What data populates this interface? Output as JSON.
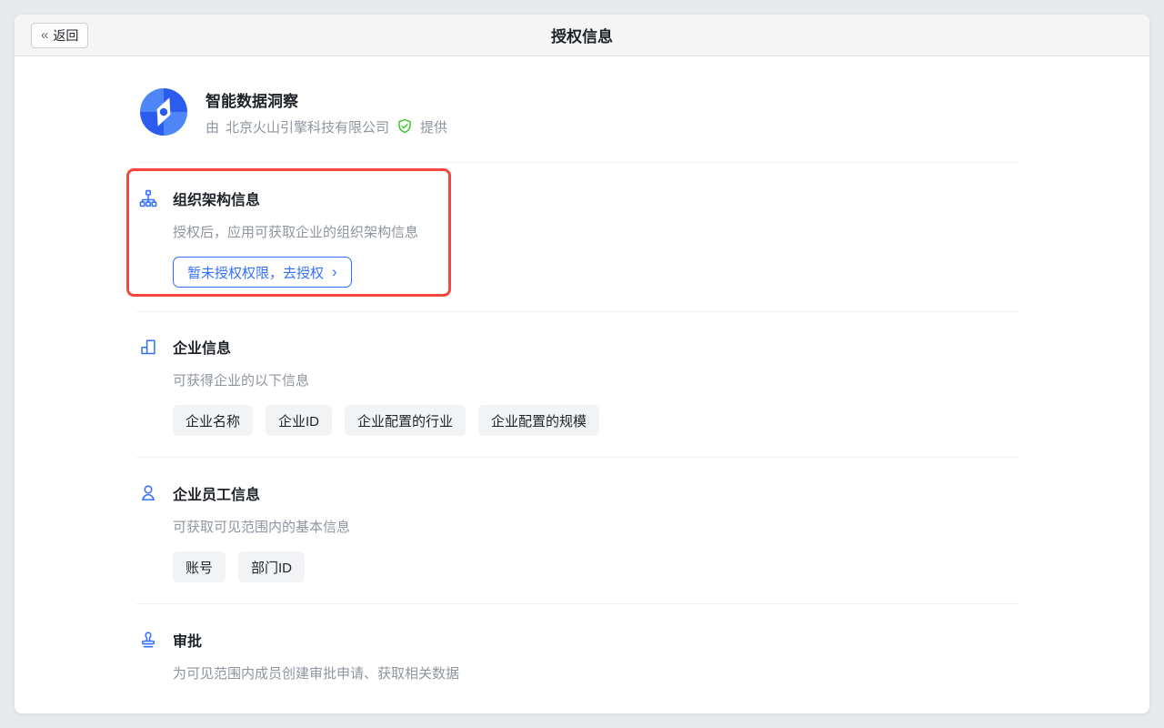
{
  "colors": {
    "accent_blue": "#3370ff",
    "annotation_red": "#f5473d",
    "shield_green": "#34c724",
    "logo_blue_light": "#4e86f8",
    "logo_blue_dark": "#2b5ced"
  },
  "header": {
    "back_icon": "«",
    "back_label": "返回",
    "title": "授权信息"
  },
  "app": {
    "name": "智能数据洞察",
    "provider_prefix": "由",
    "provider_name": "北京火山引擎科技有限公司",
    "provider_suffix": "提供"
  },
  "sections": [
    {
      "icon": "org-chart-icon",
      "title": "组织架构信息",
      "description": "授权后，应用可获取企业的组织架构信息",
      "button_label": "暂未授权权限，去授权",
      "button_chevron": "›",
      "highlighted": true
    },
    {
      "icon": "company-icon",
      "title": "企业信息",
      "description": "可获得企业的以下信息",
      "tags": [
        "企业名称",
        "企业ID",
        "企业配置的行业",
        "企业配置的规模"
      ]
    },
    {
      "icon": "person-icon",
      "title": "企业员工信息",
      "description": "可获取可见范围内的基本信息",
      "tags": [
        "账号",
        "部门ID"
      ]
    },
    {
      "icon": "stamp-icon",
      "title": "审批",
      "description": "为可见范围内成员创建审批申请、获取相关数据"
    }
  ]
}
